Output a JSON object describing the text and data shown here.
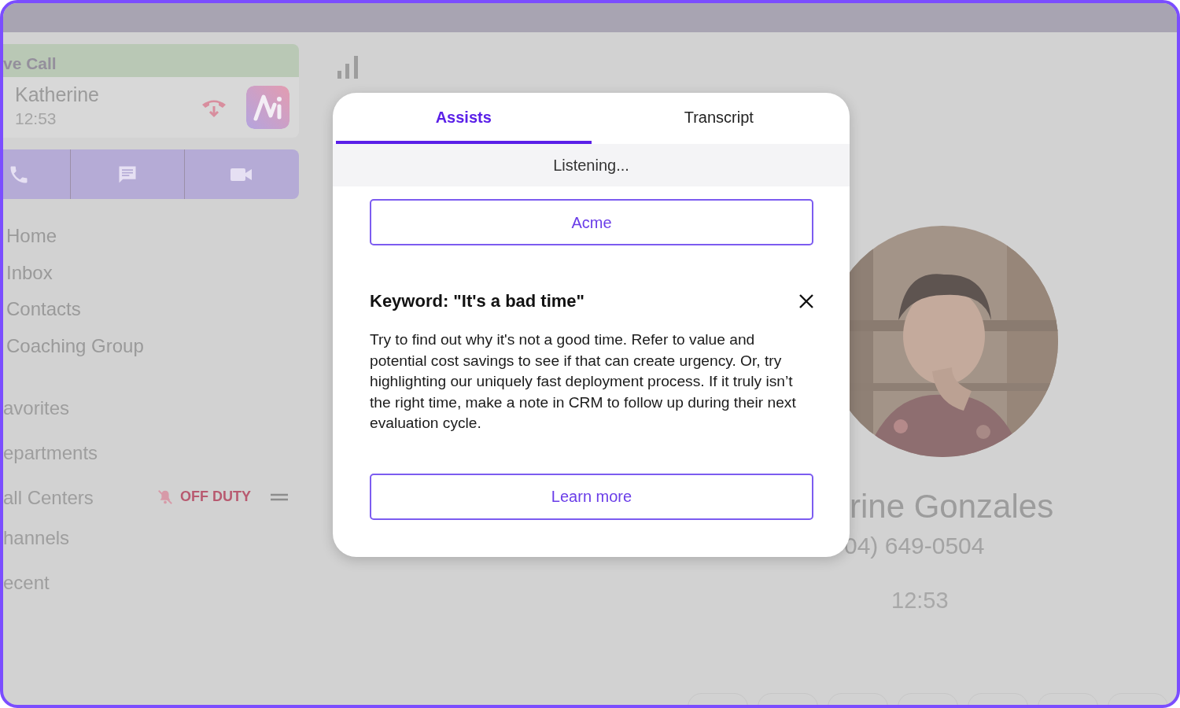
{
  "sidebar": {
    "live_call": {
      "header": "ve Call",
      "name": "Katherine",
      "duration": "12:53"
    },
    "call_actions": [
      {
        "kind": "phone"
      },
      {
        "kind": "message"
      },
      {
        "kind": "video"
      }
    ],
    "nav": [
      {
        "label": "Home"
      },
      {
        "label": "Inbox"
      },
      {
        "label": "Contacts"
      },
      {
        "label": "Coaching Group"
      }
    ],
    "sections": [
      {
        "label": "avorites"
      },
      {
        "label": "epartments"
      },
      {
        "label": "all Centers",
        "status": "OFF DUTY"
      },
      {
        "label": "hannels"
      },
      {
        "label": "ecent"
      }
    ]
  },
  "contact": {
    "name": "rine Gonzales",
    "phone": "04) 649-0504",
    "duration": "12:53"
  },
  "modal": {
    "tabs": [
      {
        "label": "Assists",
        "selected": true
      },
      {
        "label": "Transcript",
        "selected": false
      }
    ],
    "status": "Listening...",
    "company_button": "Acme",
    "card": {
      "title": "Keyword: \"It's a bad time\"",
      "body": "Try to find out why it's not a good time. Refer to value and potential cost savings to see if that can create urgency. Or, try highlighting our uniquely fast deployment process. If it truly isn’t the right time, make a note in CRM to follow up during their next evaluation cycle.",
      "button": "Learn more"
    }
  }
}
